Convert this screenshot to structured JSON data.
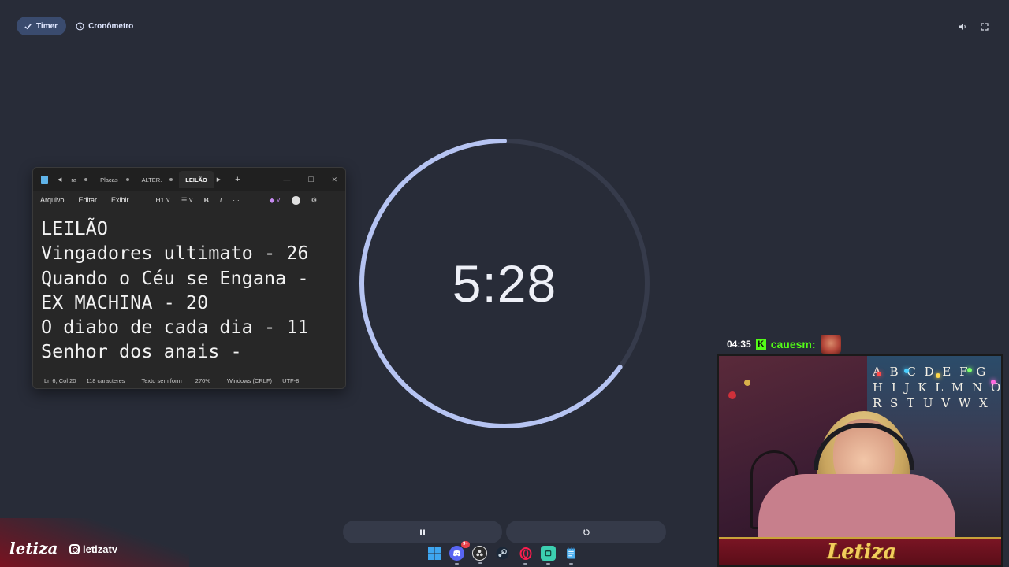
{
  "header": {
    "tab_timer": "Timer",
    "tab_stopwatch": "Cronômetro",
    "volume_icon": "volume-icon",
    "fullscreen_icon": "fullscreen-icon"
  },
  "timer": {
    "display": "5:28",
    "progress_fraction": 0.65,
    "ring_color": "#b6c4f2",
    "track_color": "#363b4b"
  },
  "controls": {
    "pause_icon": "pause-icon",
    "reset_icon": "reset-icon"
  },
  "notepad": {
    "tabs": [
      "ra",
      "Placas",
      "ALTER.",
      "LEILÃO"
    ],
    "active_tab": "LEILÃO",
    "menu": [
      "Arquivo",
      "Editar",
      "Exibir"
    ],
    "heading_select": "H1",
    "bold_label": "B",
    "italic_label": "I",
    "more_label": "···",
    "lines": [
      "LEILÃO",
      "Vingadores ultimato - 26",
      "Quando o Céu se Engana -",
      "EX MACHINA - 20",
      "O diabo de cada dia - 11",
      "Senhor dos anais -"
    ],
    "status": {
      "position": "Ln 6, Col 20",
      "chars": "118 caracteres",
      "format": "Texto sem form",
      "zoom": "270%",
      "line_ending": "Windows (CRLF)",
      "encoding": "UTF-8"
    }
  },
  "chat": {
    "time": "04:35",
    "platform_badge": "K",
    "username": "cauesm:"
  },
  "webcam": {
    "lights_text": "A B C D E F G\nH I J K L M N O\nR S T U V W X",
    "banner": "Letiza"
  },
  "branding": {
    "logo": "letiza",
    "instagram": "letizatv"
  },
  "taskbar": {
    "icons": [
      "windows-start-icon",
      "discord-icon",
      "obs-icon",
      "steam-icon",
      "opera-gx-icon",
      "app-icon",
      "notepad-icon"
    ],
    "discord_badge": "9+"
  }
}
